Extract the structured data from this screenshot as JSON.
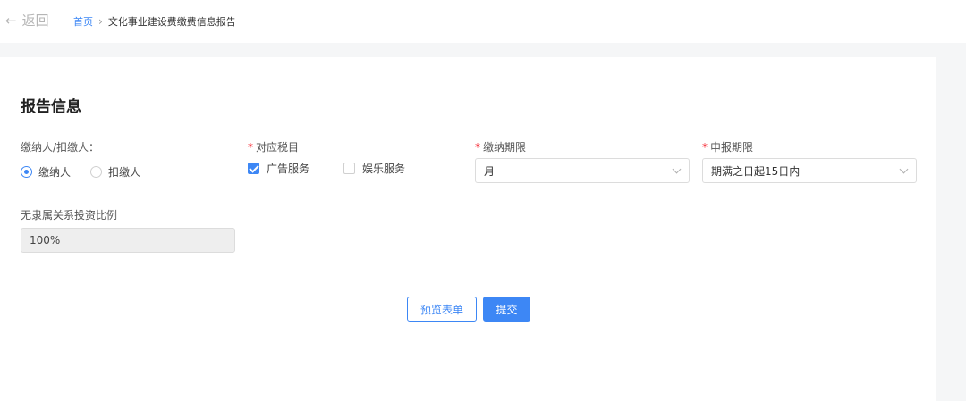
{
  "header": {
    "back_label": "返回",
    "breadcrumb": {
      "home": "首页",
      "separator": "›",
      "current": "文化事业建设费缴费信息报告"
    }
  },
  "section": {
    "title": "报告信息"
  },
  "form": {
    "payer_type": {
      "label": "缴纳人/扣缴人：",
      "options": [
        "缴纳人",
        "扣缴人"
      ],
      "selected": "缴纳人"
    },
    "tax_item": {
      "required_mark": "*",
      "label": "对应税目",
      "options": [
        {
          "label": "广告服务",
          "checked": true
        },
        {
          "label": "娱乐服务",
          "checked": false
        }
      ]
    },
    "payment_period": {
      "required_mark": "*",
      "label": "缴纳期限",
      "value": "月"
    },
    "declaration_period": {
      "required_mark": "*",
      "label": "申报期限",
      "value": "期满之日起15日内"
    },
    "investment_ratio": {
      "label": "无隶属关系投资比例",
      "value": "100%"
    }
  },
  "actions": {
    "preview_label": "预览表单",
    "submit_label": "提交"
  },
  "colors": {
    "accent": "#3d87f5",
    "required": "#f5222d",
    "page_bg": "#f5f6f7"
  }
}
